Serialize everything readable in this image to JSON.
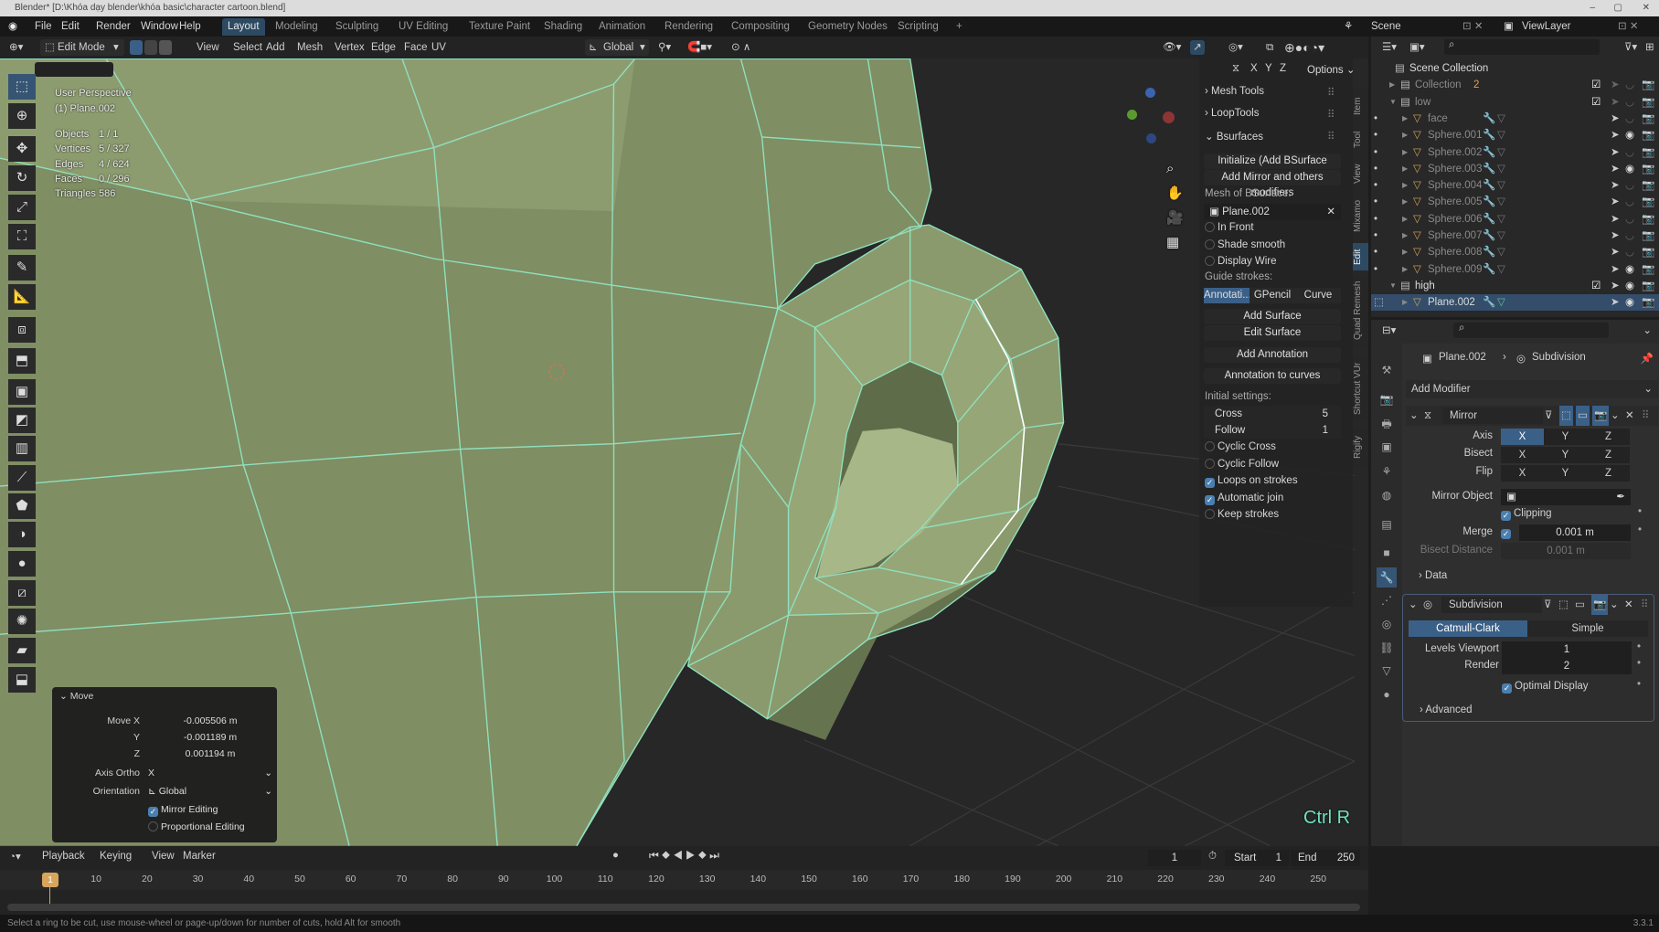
{
  "window": {
    "title": "Blender* [D:\\Khóa dạy blender\\khóa basic\\character cartoon.blend]",
    "controls": [
      "–",
      "▢",
      "✕"
    ]
  },
  "menubar": {
    "items": [
      "File",
      "Edit",
      "Render",
      "Window",
      "Help"
    ],
    "workspaces": [
      "Layout",
      "Modeling",
      "Sculpting",
      "UV Editing",
      "Texture Paint",
      "Shading",
      "Animation",
      "Rendering",
      "Compositing",
      "Geometry Nodes",
      "Scripting",
      "+"
    ],
    "active_workspace": "Layout",
    "scene": "Scene",
    "view_layer": "ViewLayer"
  },
  "header": {
    "mode": "Edit Mode",
    "menus": [
      "View",
      "Select",
      "Add",
      "Mesh",
      "Vertex",
      "Edge",
      "Face",
      "UV"
    ],
    "orientation": "Global"
  },
  "viewport": {
    "perspective": "User Perspective",
    "object": "(1) Plane.002",
    "stats": [
      {
        "label": "Objects",
        "value": "1 / 1"
      },
      {
        "label": "Vertices",
        "value": "5 / 327"
      },
      {
        "label": "Edges",
        "value": "4 / 624"
      },
      {
        "label": "Faces",
        "value": "0 / 296"
      },
      {
        "label": "Triangles",
        "value": "586"
      }
    ],
    "key_hint": "Ctrl R",
    "key_hint_color": "#6fe3c0",
    "mesh_color": "#8c9b6e",
    "wire_color": "#8fe0bf",
    "axes": [
      "X",
      "Y",
      "Z"
    ],
    "options_label": "Options"
  },
  "npanel": {
    "sections": [
      "Mesh Tools",
      "LoopTools",
      "Bsurfaces"
    ],
    "initialize": "Initialize (Add BSurface mesh)",
    "add_mirror": "Add Mirror and others modifiers",
    "mesh_label": "Mesh of BSurface:",
    "mesh_value": "Plane.002",
    "toggles1": [
      {
        "label": "In Front",
        "on": false
      },
      {
        "label": "Shade smooth",
        "on": false
      },
      {
        "label": "Display Wire",
        "on": false
      }
    ],
    "guide_label": "Guide strokes:",
    "guide_tabs": [
      "Annotati...",
      "GPencil",
      "Curve"
    ],
    "buttons": [
      "Add Surface",
      "Edit Surface",
      "Add Annotation",
      "Annotation to curves"
    ],
    "initial_label": "Initial settings:",
    "cross_label": "Cross",
    "cross": "5",
    "follow_label": "Follow",
    "follow": "1",
    "toggles2": [
      {
        "label": "Cyclic Cross",
        "on": false
      },
      {
        "label": "Cyclic Follow",
        "on": false
      },
      {
        "label": "Loops on strokes",
        "on": true
      },
      {
        "label": "Automatic join",
        "on": true
      },
      {
        "label": "Keep strokes",
        "on": false
      }
    ],
    "tabs": [
      "Item",
      "Tool",
      "View",
      "Mixamo",
      "Edit",
      "Quad Remesh",
      "Shortcut VUr",
      "Rigify"
    ],
    "active_tab": "Edit"
  },
  "outliner": {
    "rows": [
      {
        "name": "Scene Collection",
        "level": 0,
        "type": "scene"
      },
      {
        "name": "Collection",
        "level": 1,
        "type": "collection",
        "badge": "2",
        "check": true
      },
      {
        "name": "low",
        "level": 1,
        "type": "collection",
        "check": true
      },
      {
        "name": "face",
        "level": 2,
        "type": "mesh"
      },
      {
        "name": "Sphere.001",
        "level": 2,
        "type": "mesh",
        "eye": true
      },
      {
        "name": "Sphere.002",
        "level": 2,
        "type": "mesh"
      },
      {
        "name": "Sphere.003",
        "level": 2,
        "type": "mesh",
        "eye": true
      },
      {
        "name": "Sphere.004",
        "level": 2,
        "type": "mesh"
      },
      {
        "name": "Sphere.005",
        "level": 2,
        "type": "mesh"
      },
      {
        "name": "Sphere.006",
        "level": 2,
        "type": "mesh"
      },
      {
        "name": "Sphere.007",
        "level": 2,
        "type": "mesh"
      },
      {
        "name": "Sphere.008",
        "level": 2,
        "type": "mesh"
      },
      {
        "name": "Sphere.009",
        "level": 2,
        "type": "mesh",
        "eye": true
      },
      {
        "name": "high",
        "level": 1,
        "type": "collection",
        "check": true,
        "eye": true
      },
      {
        "name": "Plane.002",
        "level": 2,
        "type": "mesh",
        "eye": true,
        "selected": true
      }
    ]
  },
  "properties": {
    "breadcrumb": [
      "Plane.002",
      "Subdivision"
    ],
    "add_modifier": "Add Modifier",
    "mirror": {
      "name": "Mirror",
      "axis_label": "Axis",
      "bisect_label": "Bisect",
      "flip_label": "Flip",
      "axes": [
        "X",
        "Y",
        "Z"
      ],
      "axis_active": "X",
      "mirror_object_label": "Mirror Object",
      "clipping": "Clipping",
      "merge_label": "Merge",
      "merge": "0.001 m",
      "bisect_distance_label": "Bisect Distance",
      "bisect_distance": "0.001 m",
      "data": "Data"
    },
    "subdivision": {
      "name": "Subdivision",
      "types": [
        "Catmull-Clark",
        "Simple"
      ],
      "active_type": "Catmull-Clark",
      "levels_label": "Levels Viewport",
      "levels": "1",
      "render_label": "Render",
      "render": "2",
      "optimal": "Optimal Display",
      "advanced": "Advanced"
    }
  },
  "move_panel": {
    "title": "Move",
    "rows": [
      {
        "label": "Move X",
        "value": "-0.005506 m"
      },
      {
        "label": "Y",
        "value": "-0.001189 m"
      },
      {
        "label": "Z",
        "value": "0.001194 m"
      }
    ],
    "axis_ortho_label": "Axis Ortho",
    "axis_ortho": "X",
    "orientation_label": "Orientation",
    "orientation": "Global",
    "mirror_editing": "Mirror Editing",
    "mirror_editing_on": true,
    "proportional": "Proportional Editing",
    "proportional_on": false
  },
  "timeline": {
    "menus": [
      "Playback",
      "Keying",
      "View",
      "Marker"
    ],
    "current_frame": "1",
    "start_label": "Start",
    "start": "1",
    "end_label": "End",
    "end": "250",
    "ticks": [
      "1",
      "10",
      "20",
      "30",
      "40",
      "50",
      "60",
      "70",
      "80",
      "90",
      "100",
      "110",
      "120",
      "130",
      "140",
      "150",
      "160",
      "170",
      "180",
      "190",
      "200",
      "210",
      "220",
      "230",
      "240",
      "250"
    ]
  },
  "status": {
    "message": "Select a ring to be cut, use mouse-wheel or page-up/down for number of cuts, hold Alt for smooth",
    "version": "3.3.1"
  }
}
